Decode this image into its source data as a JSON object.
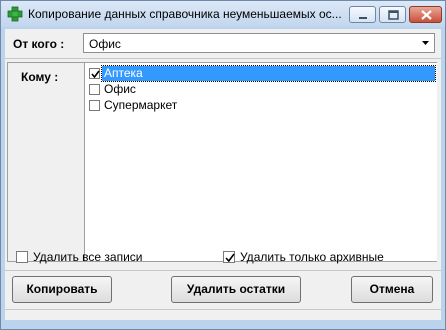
{
  "window": {
    "title": "Копирование данных справочника неуменьшаемых ос..."
  },
  "from": {
    "label": "От кого :",
    "value": "Офис"
  },
  "to": {
    "label": "Кому :",
    "items": [
      {
        "label": "Аптека",
        "checked": true,
        "selected": true
      },
      {
        "label": "Офис",
        "checked": false,
        "selected": false
      },
      {
        "label": "Супермаркет",
        "checked": false,
        "selected": false
      }
    ]
  },
  "options": {
    "delete_all": {
      "label": "Удалить все записи",
      "checked": false
    },
    "delete_archived": {
      "label": "Удалить только архивные",
      "checked": true
    }
  },
  "buttons": {
    "copy": "Копировать",
    "delete_remains": "Удалить остатки",
    "cancel": "Отмена"
  },
  "icons": {
    "app": "green-cross-icon",
    "minimize": "minimize-icon",
    "maximize": "maximize-icon",
    "close": "close-icon",
    "dropdown": "chevron-down-icon"
  }
}
